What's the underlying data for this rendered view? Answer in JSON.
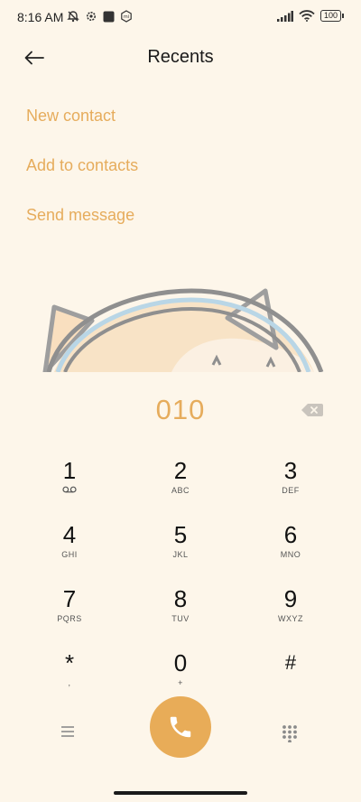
{
  "status_bar": {
    "time": "8:16 AM",
    "battery": "100"
  },
  "header": {
    "title": "Recents"
  },
  "actions": {
    "new_contact": "New contact",
    "add_to_contacts": "Add to contacts",
    "send_message": "Send message"
  },
  "dialer": {
    "number": "010",
    "keys": [
      {
        "digit": "1",
        "letters": ""
      },
      {
        "digit": "2",
        "letters": "ABC"
      },
      {
        "digit": "3",
        "letters": "DEF"
      },
      {
        "digit": "4",
        "letters": "GHI"
      },
      {
        "digit": "5",
        "letters": "JKL"
      },
      {
        "digit": "6",
        "letters": "MNO"
      },
      {
        "digit": "7",
        "letters": "PQRS"
      },
      {
        "digit": "8",
        "letters": "TUV"
      },
      {
        "digit": "9",
        "letters": "WXYZ"
      },
      {
        "digit": "*",
        "letters": ","
      },
      {
        "digit": "0",
        "letters": "+"
      },
      {
        "digit": "#",
        "letters": ""
      }
    ]
  },
  "colors": {
    "accent": "#e6ac5c",
    "background": "#fdf6ea",
    "call_button": "#e8ac58"
  },
  "icons": {
    "back": "arrow-left-icon",
    "backspace": "backspace-icon",
    "voicemail": "voicemail-icon",
    "menu": "menu-icon",
    "call": "phone-icon",
    "keypad": "dialpad-icon"
  }
}
